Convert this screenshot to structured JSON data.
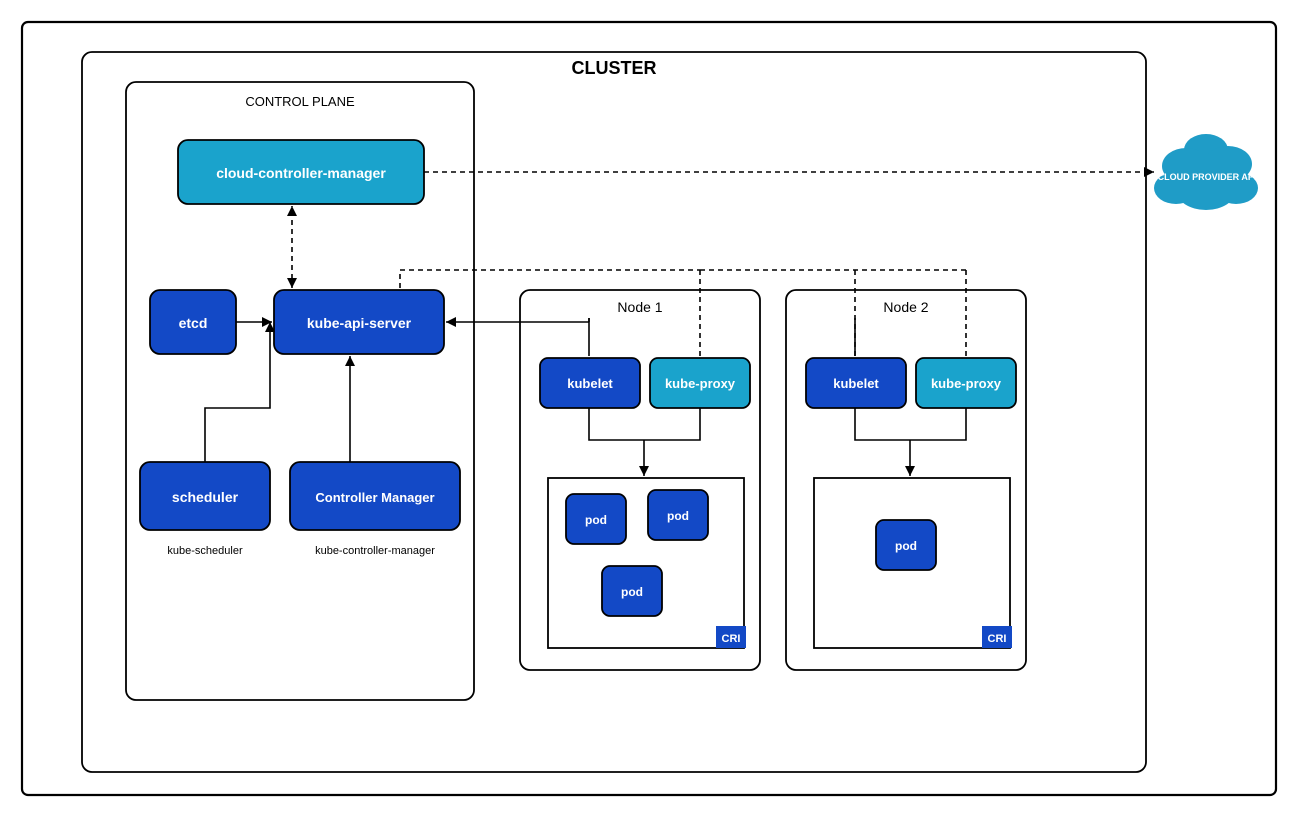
{
  "colors": {
    "navyBlue": "#1349c6",
    "skyBlue": "#1aa3cc",
    "cloudBlue": "#1f9cc7"
  },
  "cluster": {
    "title": "CLUSTER",
    "controlPlane": {
      "title": "CONTROL PLANE",
      "cloudControllerManager": "cloud-controller-manager",
      "etcd": "etcd",
      "apiServer": "kube-api-server",
      "scheduler": {
        "label": "scheduler",
        "sub": "kube-scheduler"
      },
      "controllerManager": {
        "label": "Controller Manager",
        "sub": "kube-controller-manager"
      }
    },
    "nodes": [
      {
        "title": "Node 1",
        "kubelet": "kubelet",
        "kubeProxy": "kube-proxy",
        "cri": "CRI",
        "pods": [
          "pod",
          "pod",
          "pod"
        ]
      },
      {
        "title": "Node 2",
        "kubelet": "kubelet",
        "kubeProxy": "kube-proxy",
        "cri": "CRI",
        "pods": [
          "pod"
        ]
      }
    ]
  },
  "cloudProviderApi": "CLOUD PROVIDER API"
}
